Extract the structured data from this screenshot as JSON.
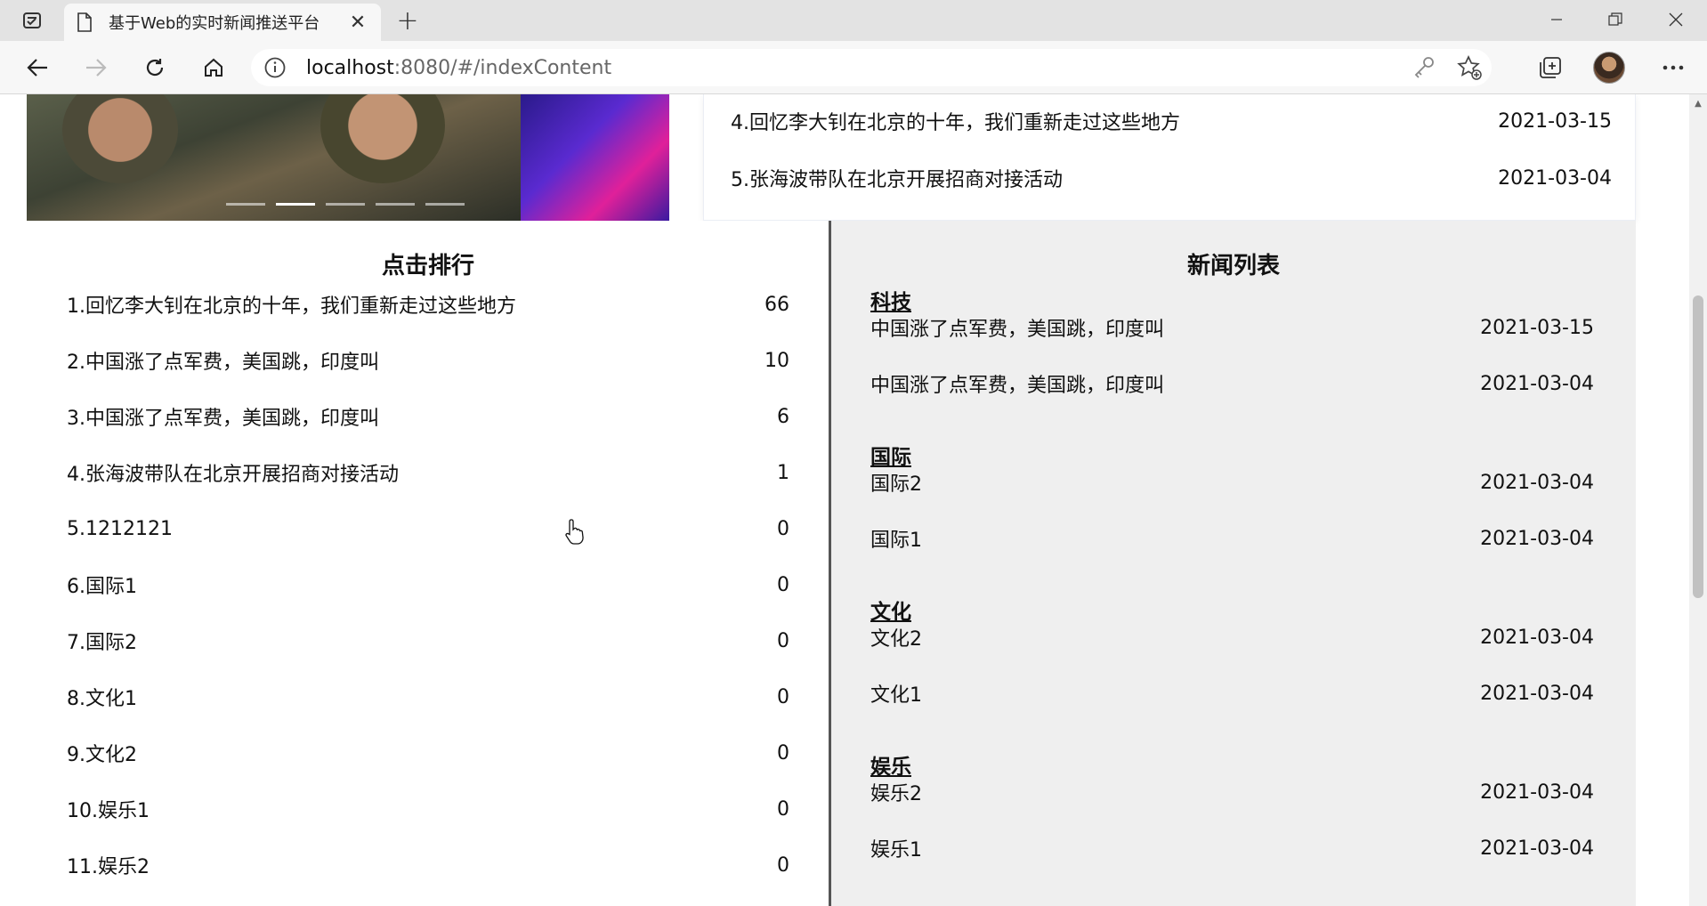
{
  "browser": {
    "tab_title": "基于Web的实时新闻推送平台",
    "url_host": "localhost",
    "url_path": ":8080/#/indexContent"
  },
  "top_news": [
    {
      "title": "4.回忆李大钊在北京的十年，我们重新走过这些地方",
      "date": "2021-03-15"
    },
    {
      "title": "5.张海波带队在北京开展招商对接活动",
      "date": "2021-03-04"
    }
  ],
  "rank": {
    "title": "点击排行",
    "items": [
      {
        "title": "1.回忆李大钊在北京的十年，我们重新走过这些地方",
        "clicks": "66"
      },
      {
        "title": "2.中国涨了点军费，美国跳，印度叫",
        "clicks": "10"
      },
      {
        "title": "3.中国涨了点军费，美国跳，印度叫",
        "clicks": "6"
      },
      {
        "title": "4.张海波带队在北京开展招商对接活动",
        "clicks": "1"
      },
      {
        "title": "5.1212121",
        "clicks": "0"
      },
      {
        "title": "6.国际1",
        "clicks": "0"
      },
      {
        "title": "7.国际2",
        "clicks": "0"
      },
      {
        "title": "8.文化1",
        "clicks": "0"
      },
      {
        "title": "9.文化2",
        "clicks": "0"
      },
      {
        "title": "10.娱乐1",
        "clicks": "0"
      },
      {
        "title": "11.娱乐2",
        "clicks": "0"
      }
    ]
  },
  "news_list": {
    "title": "新闻列表",
    "categories": [
      {
        "name": "科技",
        "items": [
          {
            "title": "中国涨了点军费，美国跳，印度叫",
            "date": "2021-03-15"
          },
          {
            "title": "中国涨了点军费，美国跳，印度叫",
            "date": "2021-03-04"
          }
        ]
      },
      {
        "name": "国际",
        "items": [
          {
            "title": "国际2",
            "date": "2021-03-04"
          },
          {
            "title": "国际1",
            "date": "2021-03-04"
          }
        ]
      },
      {
        "name": "文化",
        "items": [
          {
            "title": "文化2",
            "date": "2021-03-04"
          },
          {
            "title": "文化1",
            "date": "2021-03-04"
          }
        ]
      },
      {
        "name": "娱乐",
        "items": [
          {
            "title": "娱乐2",
            "date": "2021-03-04"
          },
          {
            "title": "娱乐1",
            "date": "2021-03-04"
          }
        ]
      }
    ]
  },
  "carousel": {
    "slide_count": 5,
    "active_index": 1
  },
  "icons": [
    "tab-actions-icon",
    "document-icon",
    "close-icon",
    "plus-icon",
    "minimize-icon",
    "restore-icon",
    "window-close-icon",
    "back-icon",
    "forward-icon",
    "refresh-icon",
    "home-icon",
    "info-icon",
    "key-icon",
    "favorite-add-icon",
    "collections-icon",
    "more-icon"
  ]
}
